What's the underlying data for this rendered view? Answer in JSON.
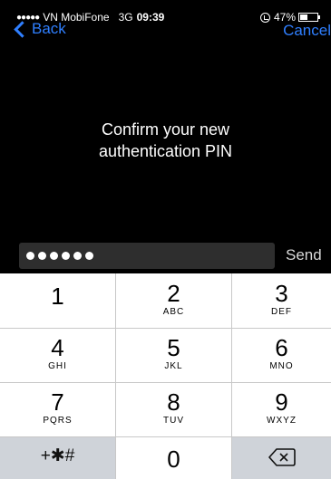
{
  "status": {
    "signal_dots": "●●●●●",
    "carrier": "VN MobiFone",
    "network": "3G",
    "time": "09:39",
    "battery": "47%",
    "battery_level": 0.47
  },
  "nav": {
    "back_label": "Back",
    "cancel_label": "Cancel"
  },
  "prompt": {
    "line1": "Confirm your new",
    "line2": "authentication PIN"
  },
  "pin": {
    "length": 6
  },
  "send_label": "Send",
  "keys": [
    {
      "num": "1",
      "letters": ""
    },
    {
      "num": "2",
      "letters": "ABC"
    },
    {
      "num": "3",
      "letters": "DEF"
    },
    {
      "num": "4",
      "letters": "GHI"
    },
    {
      "num": "5",
      "letters": "JKL"
    },
    {
      "num": "6",
      "letters": "MNO"
    },
    {
      "num": "7",
      "letters": "PQRS"
    },
    {
      "num": "8",
      "letters": "TUV"
    },
    {
      "num": "9",
      "letters": "WXYZ"
    }
  ],
  "bottom": {
    "symbols": "+✱#",
    "zero": "0"
  },
  "colors": {
    "accent": "#2f7fff",
    "background": "#000000",
    "keypad": "#ffffff",
    "key_gray": "#cfd3d9"
  }
}
